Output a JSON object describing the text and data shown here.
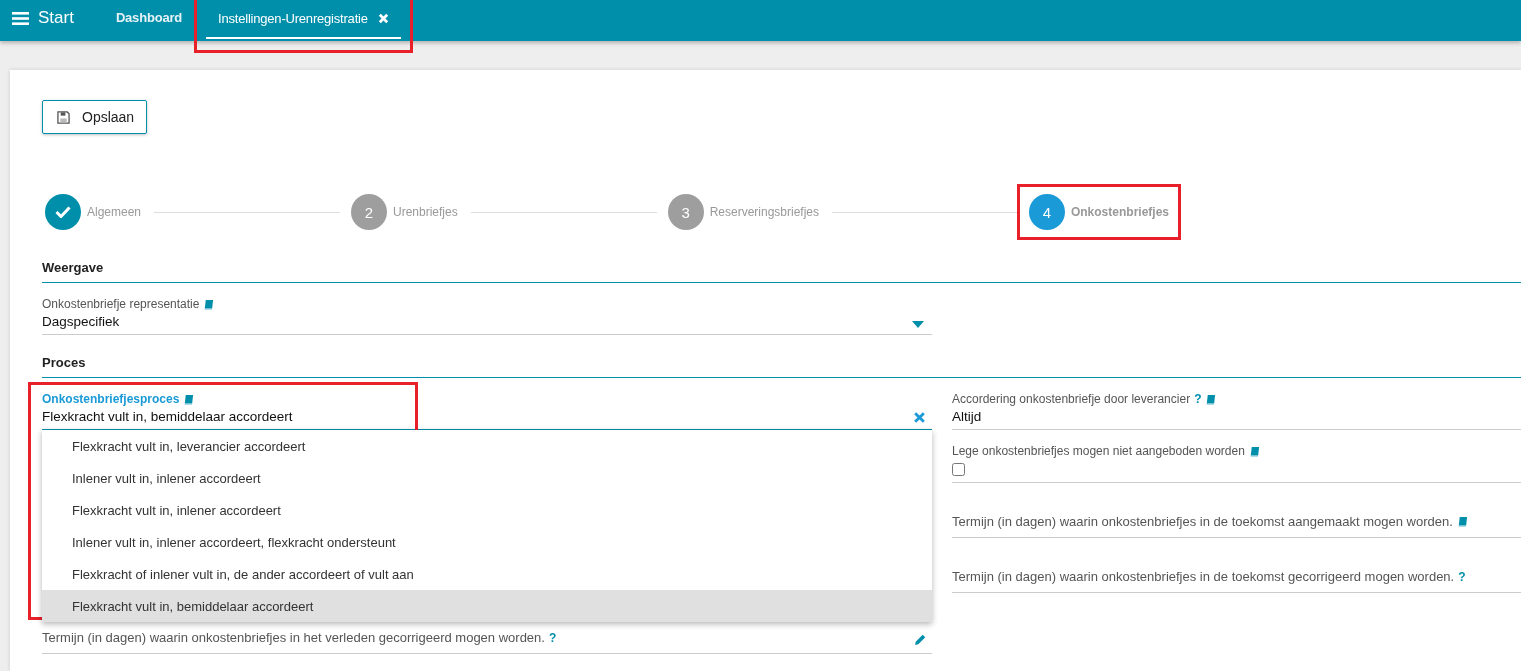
{
  "topbar": {
    "menu_label": "Start",
    "tabs": [
      {
        "label": "Dashboard",
        "selected": false,
        "closable": false,
        "highlighted": false
      },
      {
        "label": "Instellingen-Urenregistratie",
        "selected": true,
        "closable": true,
        "highlighted": true
      }
    ]
  },
  "save_button": {
    "label": "Opslaan"
  },
  "steps": [
    {
      "label": "Algemeen",
      "completed": true,
      "selected": false,
      "highlighted": false
    },
    {
      "number": "2",
      "label": "Urenbriefjes",
      "completed": false,
      "selected": false,
      "highlighted": false
    },
    {
      "number": "3",
      "label": "Reserveringsbriefjes",
      "completed": false,
      "selected": false,
      "highlighted": false
    },
    {
      "number": "4",
      "label": "Onkostenbriefjes",
      "completed": false,
      "selected": true,
      "highlighted": true
    }
  ],
  "sections": [
    {
      "title": "Weergave",
      "left": [
        {
          "kind": "select",
          "label": "Onkostenbriefje representatie",
          "value": "Dagspecifiek",
          "manual": true
        }
      ]
    },
    {
      "title": "Proces",
      "left": [
        {
          "kind": "combobox",
          "label": "Onkostenbriefjesproces",
          "value": "Flexkracht vult in, bemiddelaar accordeert",
          "manual": true,
          "highlighted": true,
          "expanded": true,
          "options": [
            {
              "label": "Flexkracht vult in, leverancier accordeert",
              "selected": false
            },
            {
              "label": "Inlener vult in, inlener accordeert",
              "selected": false
            },
            {
              "label": "Flexkracht vult in, inlener accordeert",
              "selected": false
            },
            {
              "label": "Inlener vult in, inlener accordeert, flexkracht ondersteunt",
              "selected": false
            },
            {
              "label": "Flexkracht of inlener vult in, de ander accordeert of vult aan",
              "selected": false
            },
            {
              "label": "Flexkracht vult in, bemiddelaar accordeert",
              "selected": true
            }
          ]
        },
        {
          "kind": "number",
          "label": "Termijn (in dagen) waarin onkostenbriefjes in het verleden gecorrigeerd mogen worden.",
          "help": "?",
          "manual": false,
          "editable": true
        }
      ],
      "right": [
        {
          "kind": "value",
          "label": "Accordering onkostenbriefje door leverancier",
          "value": "Altijd",
          "help": "?",
          "manual": true
        },
        {
          "kind": "checkbox",
          "label": "Lege onkostenbriefjes mogen niet aangeboden worden",
          "checked": false,
          "manual": true
        },
        {
          "kind": "number",
          "label": "Termijn (in dagen) waarin onkostenbriefjes in de toekomst aangemaakt mogen worden.",
          "manual": true,
          "editable": false
        },
        {
          "kind": "number",
          "label": "Termijn (in dagen) waarin onkostenbriefjes in de toekomst gecorrigeerd mogen worden.",
          "help": "?",
          "manual": false,
          "editable": false
        }
      ]
    }
  ]
}
